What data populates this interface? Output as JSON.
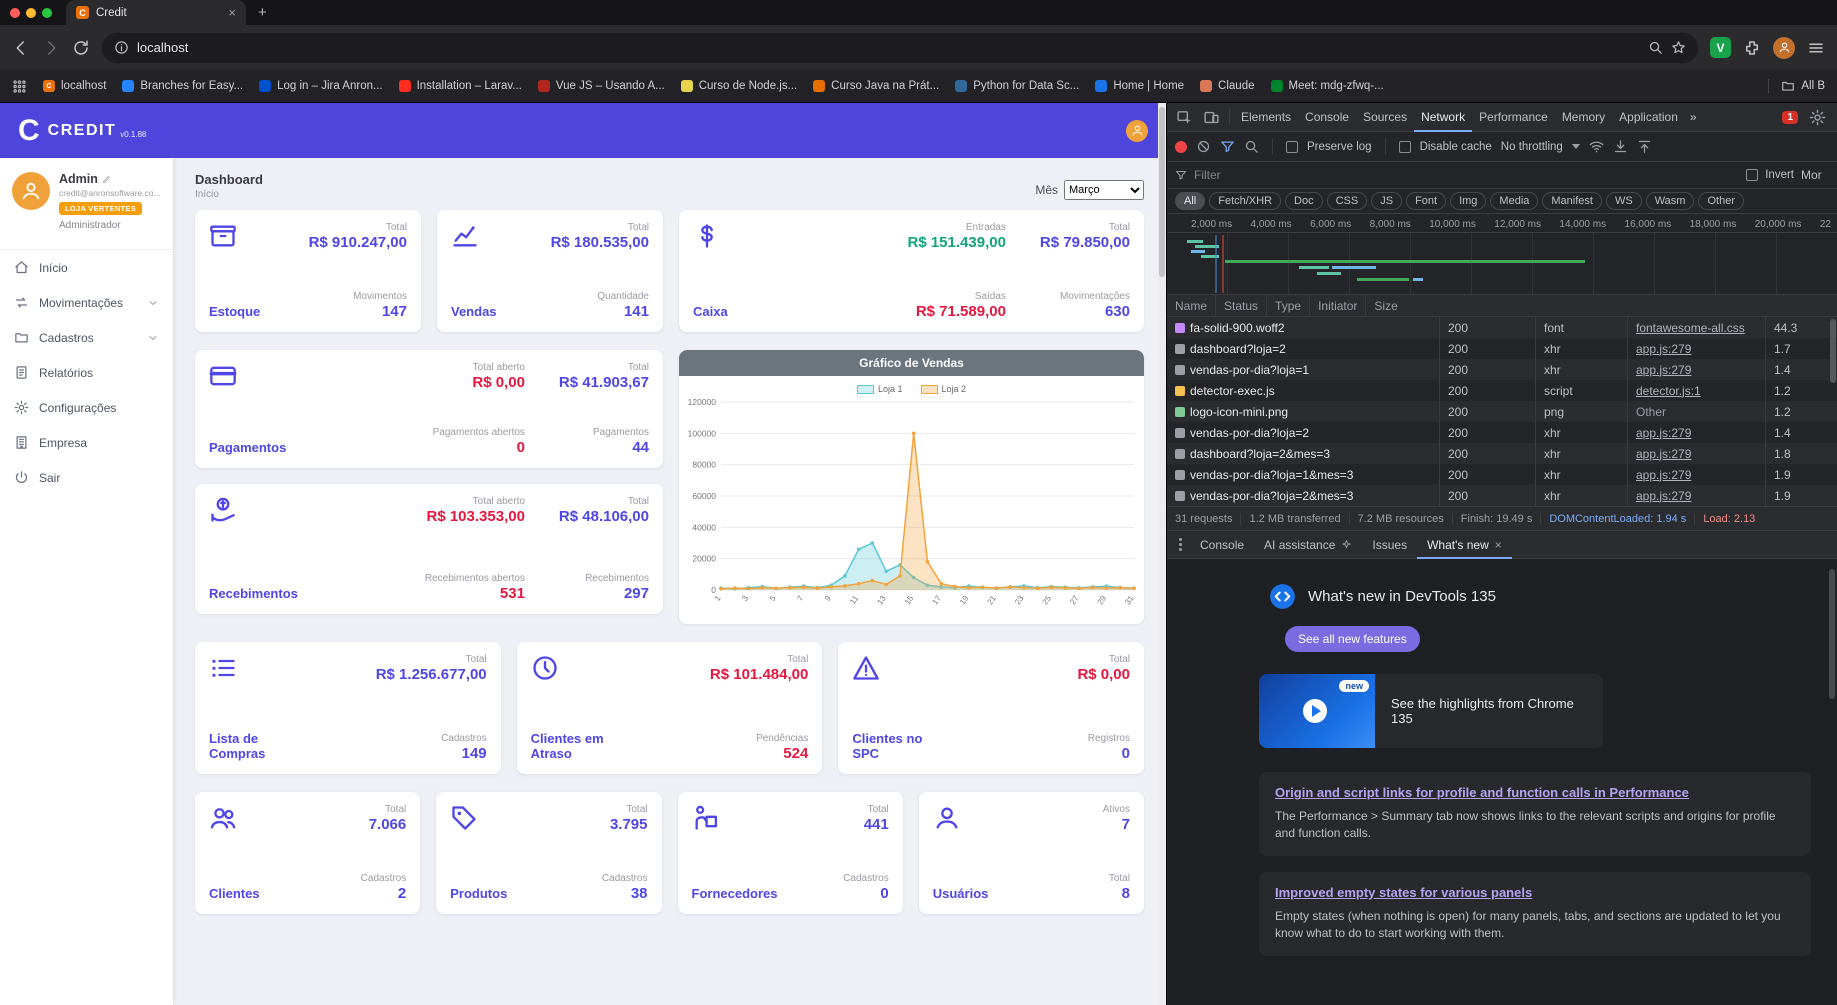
{
  "colors": {
    "accent": "#4f46e5",
    "header_bg": "#4e46dc",
    "main_bg": "#eef0f6",
    "red": "#e5173f",
    "green": "#12a57c",
    "orange": "#f59e0b",
    "chart_header_bg": "#6c757d",
    "loja1": "#5bc8d6",
    "loja1_fill": "#d2eff3",
    "loja2": "#f2a33c",
    "loja2_fill": "#fbe3c2",
    "dt_blue": "#7cacf8",
    "dt_red": "#f28b82",
    "dt_violet": "#b5a3f2",
    "dt_button": "#7a6ce0"
  },
  "glyphs": {
    "close": "×",
    "plus": "+",
    "more_tabs": "»"
  },
  "browser": {
    "tab_title": "Credit",
    "favicon_letter": "C",
    "url": "localhost",
    "extension_letter": "V",
    "all_bookmarks_label": "All B",
    "bookmarks": [
      {
        "label": "localhost",
        "color": "#e8710a",
        "letter": "C"
      },
      {
        "label": "Branches for Easy...",
        "color": "#2684ff"
      },
      {
        "label": "Log in – Jira Anron...",
        "color": "#0052cc"
      },
      {
        "label": "Installation – Larav...",
        "color": "#ff2d20"
      },
      {
        "label": "Vue JS – Usando A...",
        "color": "#b3261e"
      },
      {
        "label": "Curso de Node.js...",
        "color": "#e8d44d"
      },
      {
        "label": "Curso Java na Prát...",
        "color": "#e76f00"
      },
      {
        "label": "Python for Data Sc...",
        "color": "#306998"
      },
      {
        "label": "Home | Home",
        "color": "#1a73e8"
      },
      {
        "label": "Claude",
        "color": "#d97757"
      },
      {
        "label": "Meet: mdg-zfwq-...",
        "color": "#00832d"
      }
    ]
  },
  "app": {
    "logo_letter": "C",
    "logo_name": "CREDIT",
    "version": "v0.1.88",
    "profile": {
      "name": "Admin",
      "email": "credit@anronsoftware.co...",
      "store_badge": "LOJA VERTENTES",
      "role": "Administrador"
    },
    "menu": {
      "inicio": "Início",
      "movimentacoes": "Movimentações",
      "cadastros": "Cadastros",
      "relatorios": "Relatórios",
      "configuracoes": "Configurações",
      "empresa": "Empresa",
      "sair": "Sair"
    },
    "page_title": "Dashboard",
    "page_subtitle": "Início",
    "month_label": "Mês",
    "month_value": "Março",
    "cards": {
      "estoque": {
        "label": "Estoque",
        "stats": [
          {
            "l": "Total",
            "v": "R$ 910.247,00",
            "c": "purple"
          },
          {
            "l": "Movimentos",
            "v": "147",
            "c": "purple"
          }
        ]
      },
      "vendas": {
        "label": "Vendas",
        "stats": [
          {
            "l": "Total",
            "v": "R$ 180.535,00",
            "c": "purple"
          },
          {
            "l": "Quantidade",
            "v": "141",
            "c": "purple"
          }
        ]
      },
      "caixa": {
        "label": "Caixa",
        "col1": [
          {
            "l": "Entradas",
            "v": "R$ 151.439,00",
            "c": "green"
          },
          {
            "l": "Saídas",
            "v": "R$ 71.589,00",
            "c": "red"
          }
        ],
        "col2": [
          {
            "l": "Total",
            "v": "R$ 79.850,00",
            "c": "purple"
          },
          {
            "l": "Movimentações",
            "v": "630",
            "c": "purple"
          }
        ]
      },
      "pagamentos": {
        "label": "Pagamentos",
        "col1": [
          {
            "l": "Total aberto",
            "v": "R$ 0,00",
            "c": "red"
          },
          {
            "l": "Pagamentos abertos",
            "v": "0",
            "c": "red"
          }
        ],
        "col2": [
          {
            "l": "Total",
            "v": "R$ 41.903,67",
            "c": "purple"
          },
          {
            "l": "Pagamentos",
            "v": "44",
            "c": "purple"
          }
        ]
      },
      "recebimentos": {
        "label": "Recebimentos",
        "col1": [
          {
            "l": "Total aberto",
            "v": "R$ 103.353,00",
            "c": "red"
          },
          {
            "l": "Recebimentos abertos",
            "v": "531",
            "c": "red"
          }
        ],
        "col2": [
          {
            "l": "Total",
            "v": "R$ 48.106,00",
            "c": "purple"
          },
          {
            "l": "Recebimentos",
            "v": "297",
            "c": "purple"
          }
        ]
      },
      "lista_compras": {
        "label": "Lista de Compras",
        "stats": [
          {
            "l": "Total",
            "v": "R$ 1.256.677,00",
            "c": "purple"
          },
          {
            "l": "Cadastros",
            "v": "149",
            "c": "purple"
          }
        ]
      },
      "clientes_atraso": {
        "label": "Clientes em Atraso",
        "stats": [
          {
            "l": "Total",
            "v": "R$ 101.484,00",
            "c": "red"
          },
          {
            "l": "Pendências",
            "v": "524",
            "c": "red"
          }
        ]
      },
      "clientes_spc": {
        "label": "Clientes no SPC",
        "stats": [
          {
            "l": "Total",
            "v": "R$ 0,00",
            "c": "red"
          },
          {
            "l": "Registros",
            "v": "0",
            "c": "purple"
          }
        ]
      },
      "clientes": {
        "label": "Clientes",
        "stats": [
          {
            "l": "Total",
            "v": "7.066",
            "c": "purple"
          },
          {
            "l": "Cadastros",
            "v": "2",
            "c": "purple"
          }
        ]
      },
      "produtos": {
        "label": "Produtos",
        "stats": [
          {
            "l": "Total",
            "v": "3.795",
            "c": "purple"
          },
          {
            "l": "Cadastros",
            "v": "38",
            "c": "purple"
          }
        ]
      },
      "fornecedores": {
        "label": "Fornecedores",
        "stats": [
          {
            "l": "Total",
            "v": "441",
            "c": "purple"
          },
          {
            "l": "Cadastros",
            "v": "0",
            "c": "purple"
          }
        ]
      },
      "usuarios": {
        "label": "Usuários",
        "stats": [
          {
            "l": "Ativos",
            "v": "7",
            "c": "purple"
          },
          {
            "l": "Total",
            "v": "8",
            "c": "purple"
          }
        ]
      }
    }
  },
  "chart_data": {
    "type": "area",
    "title": "Gráfico de Vendas",
    "xlabel": "",
    "ylabel": "",
    "ylim": [
      0,
      120000
    ],
    "ytick_step": 20000,
    "grid": true,
    "legend_position": "top",
    "days": [
      1,
      2,
      3,
      4,
      5,
      6,
      7,
      8,
      9,
      10,
      11,
      12,
      13,
      14,
      15,
      16,
      17,
      18,
      19,
      20,
      21,
      22,
      23,
      24,
      25,
      26,
      27,
      28,
      29,
      30,
      31
    ],
    "series": [
      {
        "name": "Loja 1",
        "values": [
          1200,
          800,
          1500,
          2200,
          1000,
          1800,
          2500,
          1500,
          3000,
          9000,
          26000,
          30000,
          12000,
          16000,
          8000,
          3000,
          2000,
          1500,
          2500,
          1800,
          1200,
          2000,
          2600,
          1500,
          2200,
          1800,
          1400,
          2000,
          2400,
          1600,
          1200
        ]
      },
      {
        "name": "Loja 2",
        "values": [
          800,
          1200,
          900,
          1500,
          1100,
          1400,
          1800,
          1200,
          2000,
          2600,
          4000,
          6000,
          3500,
          9000,
          100000,
          18000,
          4000,
          2200,
          1500,
          1800,
          1200,
          2000,
          1500,
          1100,
          1800,
          1400,
          1000,
          1600,
          1200,
          1500,
          1000
        ]
      }
    ]
  },
  "devtools": {
    "tabs": [
      {
        "label": "Elements"
      },
      {
        "label": "Console"
      },
      {
        "label": "Sources"
      },
      {
        "label": "Network",
        "cls": "active"
      },
      {
        "label": "Performance"
      },
      {
        "label": "Memory"
      },
      {
        "label": "Application"
      }
    ],
    "error_badge": "1",
    "network": {
      "preserve_log_label": "Preserve log",
      "disable_cache_label": "Disable cache",
      "throttling_label": "No throttling",
      "filter_placeholder": "Filter",
      "invert_label": "Invert",
      "more_label": "Mor",
      "chips": [
        {
          "label": "All",
          "cls": "active"
        },
        {
          "label": "Fetch/XHR"
        },
        {
          "label": "Doc"
        },
        {
          "label": "CSS"
        },
        {
          "label": "JS"
        },
        {
          "label": "Font"
        },
        {
          "label": "Img"
        },
        {
          "label": "Media"
        },
        {
          "label": "Manifest"
        },
        {
          "label": "WS"
        },
        {
          "label": "Wasm"
        },
        {
          "label": "Other"
        }
      ],
      "ruler": [
        "2,000 ms",
        "4,000 ms",
        "6,000 ms",
        "8,000 ms",
        "10,000 ms",
        "12,000 ms",
        "14,000 ms",
        "16,000 ms",
        "18,000 ms",
        "20,000 ms",
        "22"
      ],
      "columns": [
        "Name",
        "Status",
        "Type",
        "Initiator",
        "Size"
      ],
      "rows": [
        {
          "name": "fa-solid-900.woff2",
          "status": "200",
          "type": "font",
          "initiator": "fontawesome-all.css",
          "size": "44.3",
          "tclass": "t-font",
          "iclass": "init_link"
        },
        {
          "name": "dashboard?loja=2",
          "status": "200",
          "type": "xhr",
          "initiator": "app.js:279",
          "size": "1.7",
          "tclass": "t-xhr",
          "iclass": "init_link"
        },
        {
          "name": "vendas-por-dia?loja=1",
          "status": "200",
          "type": "xhr",
          "initiator": "app.js:279",
          "size": "1.4",
          "tclass": "t-xhr",
          "iclass": "init_link"
        },
        {
          "name": "detector-exec.js",
          "status": "200",
          "type": "script",
          "initiator": "detector.js:1",
          "size": "1.2",
          "tclass": "t-script",
          "iclass": "init_link"
        },
        {
          "name": "logo-icon-mini.png",
          "status": "200",
          "type": "png",
          "initiator": "Other",
          "size": "1.2",
          "tclass": "t-img",
          "iclass": "init_plain"
        },
        {
          "name": "vendas-por-dia?loja=2",
          "status": "200",
          "type": "xhr",
          "initiator": "app.js:279",
          "size": "1.4",
          "tclass": "t-xhr",
          "iclass": "init_link"
        },
        {
          "name": "dashboard?loja=2&mes=3",
          "status": "200",
          "type": "xhr",
          "initiator": "app.js:279",
          "size": "1.8",
          "tclass": "t-xhr",
          "iclass": "init_link"
        },
        {
          "name": "vendas-por-dia?loja=1&mes=3",
          "status": "200",
          "type": "xhr",
          "initiator": "app.js:279",
          "size": "1.9",
          "tclass": "t-xhr",
          "iclass": "init_link"
        },
        {
          "name": "vendas-por-dia?loja=2&mes=3",
          "status": "200",
          "type": "xhr",
          "initiator": "app.js:279",
          "size": "1.9",
          "tclass": "t-xhr",
          "iclass": "init_link"
        }
      ],
      "summary": [
        {
          "t": "31 requests"
        },
        {
          "t": "1.2 MB transferred"
        },
        {
          "t": "7.2 MB resources"
        },
        {
          "t": "Finish: 19.49 s"
        },
        {
          "t": "DOMContentLoaded: 1.94 s",
          "cls": "blue"
        },
        {
          "t": "Load: 2.13",
          "cls": "red"
        }
      ]
    },
    "drawer": {
      "console": "Console",
      "ai": "AI assistance",
      "issues": "Issues",
      "whatsnew": "What's new"
    },
    "whatsnew": {
      "title": "What's new in DevTools 135",
      "button": "See all new features",
      "badge": "new",
      "highlight": "See the highlights from Chrome 135",
      "sections": [
        {
          "heading": "Origin and script links for profile and function calls in Performance",
          "body": "The Performance > Summary tab now shows links to the relevant scripts and origins for profile and function calls."
        },
        {
          "heading": "Improved empty states for various panels",
          "body": "Empty states (when nothing is open) for many panels, tabs, and sections are updated to let you know what to do to start working with them."
        }
      ]
    }
  }
}
